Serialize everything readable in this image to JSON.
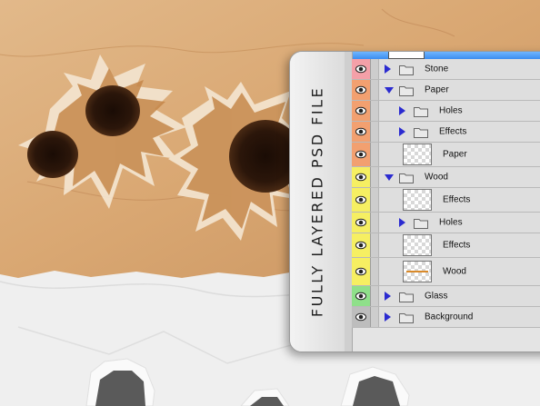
{
  "panel": {
    "side_label": "FULLY LAYERED PSD FILE"
  },
  "colors": {
    "pink": "#f4a0a8",
    "orange": "#f2a070",
    "yellow": "#f6ef62",
    "green": "#8fe08a",
    "gray": "#bdbdbd"
  },
  "layers": [
    {
      "name": "Stone",
      "kind": "group",
      "expanded": false,
      "indent": 0,
      "color": "pink"
    },
    {
      "name": "Paper",
      "kind": "group",
      "expanded": true,
      "indent": 0,
      "color": "orange"
    },
    {
      "name": "Holes",
      "kind": "group",
      "expanded": false,
      "indent": 1,
      "color": "orange"
    },
    {
      "name": "Effects",
      "kind": "group",
      "expanded": false,
      "indent": 1,
      "color": "orange"
    },
    {
      "name": "Paper",
      "kind": "layer",
      "thumb": "blank",
      "indent": 1,
      "color": "orange"
    },
    {
      "name": "Wood",
      "kind": "group",
      "expanded": true,
      "indent": 0,
      "color": "yellow"
    },
    {
      "name": "Effects",
      "kind": "layer",
      "thumb": "blank",
      "indent": 1,
      "color": "yellow"
    },
    {
      "name": "Holes",
      "kind": "group",
      "expanded": false,
      "indent": 1,
      "color": "yellow"
    },
    {
      "name": "Effects",
      "kind": "layer",
      "thumb": "blank",
      "indent": 1,
      "color": "yellow"
    },
    {
      "name": "Wood",
      "kind": "layer",
      "thumb": "wood",
      "indent": 1,
      "color": "yellow"
    },
    {
      "name": "Glass",
      "kind": "group",
      "expanded": false,
      "indent": 0,
      "color": "green"
    },
    {
      "name": "Background",
      "kind": "group",
      "expanded": false,
      "indent": 0,
      "color": "gray"
    }
  ]
}
